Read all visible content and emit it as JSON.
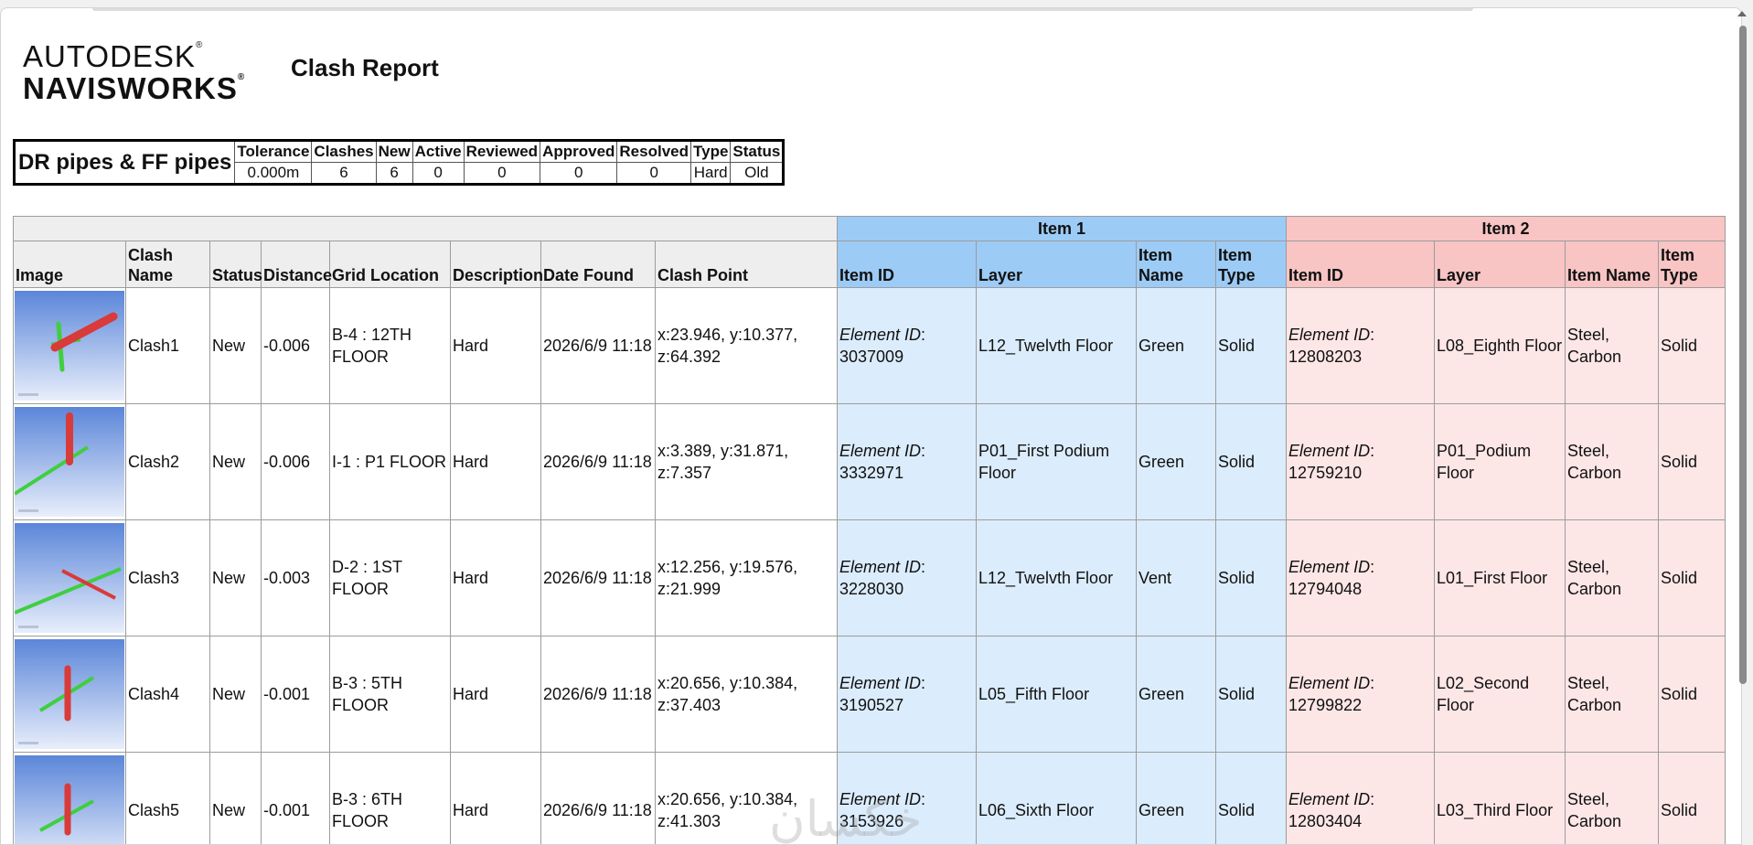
{
  "logo": {
    "line1": "AUTODESK",
    "line2": "NAVISWORKS",
    "reg": "®"
  },
  "report_title": "Clash Report",
  "summary": {
    "test_name": "DR pipes & FF pipes",
    "headers": [
      "Tolerance",
      "Clashes",
      "New",
      "Active",
      "Reviewed",
      "Approved",
      "Resolved",
      "Type",
      "Status"
    ],
    "values": [
      "0.000m",
      "6",
      "6",
      "0",
      "0",
      "0",
      "0",
      "Hard",
      "Old"
    ]
  },
  "table": {
    "group_item1": "Item 1",
    "group_item2": "Item 2",
    "columns": {
      "image": "Image",
      "clash_name": "Clash Name",
      "status": "Status",
      "distance": "Distance",
      "grid_location": "Grid Location",
      "description": "Description",
      "date_found": "Date Found",
      "clash_point": "Clash Point",
      "item1_id": "Item ID",
      "item1_layer": "Layer",
      "item1_name": "Item Name",
      "item1_type": "Item Type",
      "item2_id": "Item ID",
      "item2_layer": "Layer",
      "item2_name": "Item Name",
      "item2_type": "Item Type"
    },
    "element_id_label": "Element ID",
    "rows": [
      {
        "name": "Clash1",
        "status": "New",
        "distance": "-0.006",
        "grid": "B-4 : 12TH FLOOR",
        "description": "Hard",
        "date": "2026/6/9 11:18",
        "point": "x:23.946, y:10.377, z:64.392",
        "i1_id": "3037009",
        "i1_layer": "L12_Twelvth Floor",
        "i1_name": "Green",
        "i1_type": "Solid",
        "i2_id": "12808203",
        "i2_layer": "L08_Eighth Floor",
        "i2_name": "Steel, Carbon",
        "i2_type": "Solid"
      },
      {
        "name": "Clash2",
        "status": "New",
        "distance": "-0.006",
        "grid": "I-1 : P1 FLOOR",
        "description": "Hard",
        "date": "2026/6/9 11:18",
        "point": "x:3.389, y:31.871, z:7.357",
        "i1_id": "3332971",
        "i1_layer": "P01_First Podium Floor",
        "i1_name": "Green",
        "i1_type": "Solid",
        "i2_id": "12759210",
        "i2_layer": "P01_Podium Floor",
        "i2_name": "Steel, Carbon",
        "i2_type": "Solid"
      },
      {
        "name": "Clash3",
        "status": "New",
        "distance": "-0.003",
        "grid": "D-2 : 1ST FLOOR",
        "description": "Hard",
        "date": "2026/6/9 11:18",
        "point": "x:12.256, y:19.576, z:21.999",
        "i1_id": "3228030",
        "i1_layer": "L12_Twelvth Floor",
        "i1_name": "Vent",
        "i1_type": "Solid",
        "i2_id": "12794048",
        "i2_layer": "L01_First Floor",
        "i2_name": "Steel, Carbon",
        "i2_type": "Solid"
      },
      {
        "name": "Clash4",
        "status": "New",
        "distance": "-0.001",
        "grid": "B-3 : 5TH FLOOR",
        "description": "Hard",
        "date": "2026/6/9 11:18",
        "point": "x:20.656, y:10.384, z:37.403",
        "i1_id": "3190527",
        "i1_layer": "L05_Fifth Floor",
        "i1_name": "Green",
        "i1_type": "Solid",
        "i2_id": "12799822",
        "i2_layer": "L02_Second Floor",
        "i2_name": "Steel, Carbon",
        "i2_type": "Solid"
      },
      {
        "name": "Clash5",
        "status": "New",
        "distance": "-0.001",
        "grid": "B-3 : 6TH FLOOR",
        "description": "Hard",
        "date": "2026/6/9 11:18",
        "point": "x:20.656, y:10.384, z:41.303",
        "i1_id": "3153926",
        "i1_layer": "L06_Sixth Floor",
        "i1_name": "Green",
        "i1_type": "Solid",
        "i2_id": "12803404",
        "i2_layer": "L03_Third Floor",
        "i2_name": "Steel, Carbon",
        "i2_type": "Solid"
      }
    ]
  },
  "watermark": "خکسان",
  "colors": {
    "item1_header": "#9ccbf6",
    "item1_cell": "#dbecfc",
    "item2_header": "#f8c4c4",
    "item2_cell": "#fde6e6",
    "pipe_red": "#d93a3a",
    "pipe_green": "#3fcf3f",
    "thumb_sky": "#5b86d9"
  }
}
